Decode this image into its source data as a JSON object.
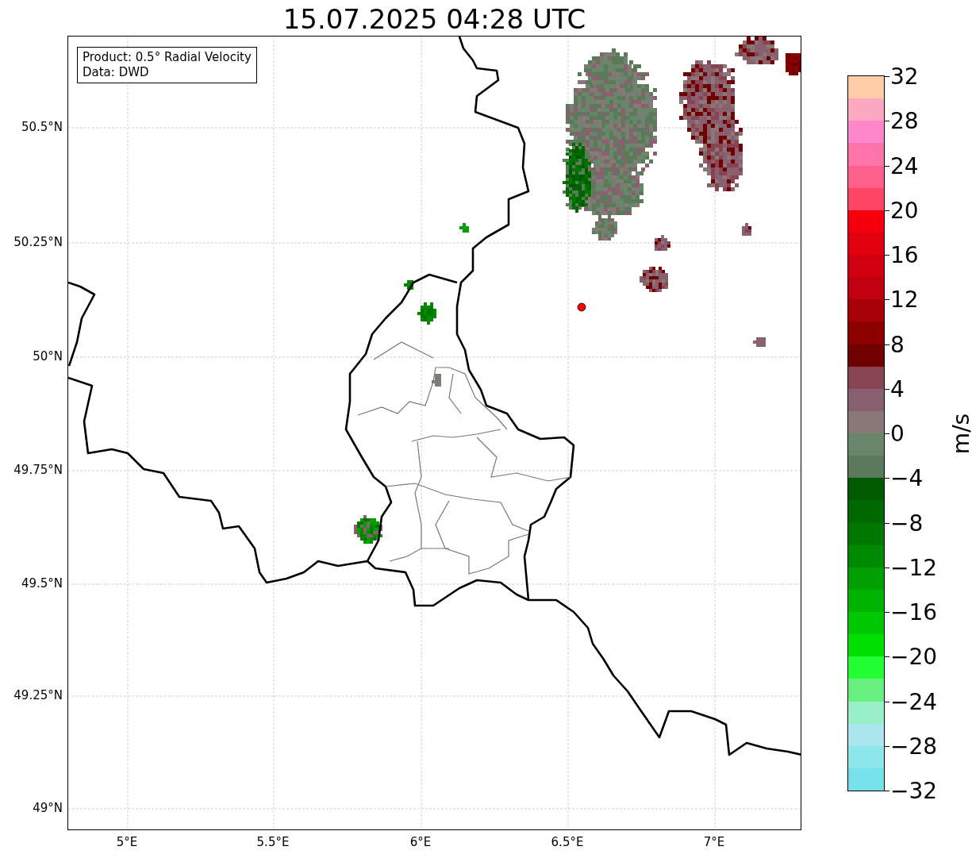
{
  "title": "15.07.2025 04:28 UTC",
  "info_box": {
    "lines": [
      "Product: 0.5° Radial Velocity",
      "Data: DWD"
    ]
  },
  "map": {
    "y_ticks": [
      "50.5°N",
      "50.25°N",
      "50°N",
      "49.75°N",
      "49.5°N",
      "49.25°N",
      "49°N"
    ],
    "x_ticks": [
      "5°E",
      "5.5°E",
      "6°E",
      "6.5°E",
      "7°E"
    ]
  },
  "colorbar": {
    "label": "m/s",
    "ticks": [
      "32",
      "28",
      "24",
      "20",
      "16",
      "12",
      "8",
      "4",
      "0",
      "−4",
      "−8",
      "−12",
      "−16",
      "−20",
      "−24",
      "−28",
      "−32"
    ],
    "segments": [
      {
        "color": "#ffcca8"
      },
      {
        "color": "#ffa8c4"
      },
      {
        "color": "#ff88cc"
      },
      {
        "color": "#ff74a8"
      },
      {
        "color": "#ff608c"
      },
      {
        "color": "#ff4466"
      },
      {
        "color": "#f5000c"
      },
      {
        "color": "#e0000e"
      },
      {
        "color": "#d00010"
      },
      {
        "color": "#c00010"
      },
      {
        "color": "#a80008"
      },
      {
        "color": "#8c0000"
      },
      {
        "color": "#700000"
      },
      {
        "color": "#884450"
      },
      {
        "color": "#886070"
      },
      {
        "color": "#887878"
      },
      {
        "color": "#6a866a"
      },
      {
        "color": "#5a7a5a"
      },
      {
        "color": "#005a00"
      },
      {
        "color": "#006800"
      },
      {
        "color": "#007800"
      },
      {
        "color": "#008a00"
      },
      {
        "color": "#00a000"
      },
      {
        "color": "#00b400"
      },
      {
        "color": "#00c800"
      },
      {
        "color": "#00e000"
      },
      {
        "color": "#22ff33"
      },
      {
        "color": "#66f080"
      },
      {
        "color": "#99f0c8"
      },
      {
        "color": "#abe6ee"
      },
      {
        "color": "#8ce8ec"
      },
      {
        "color": "#74e2e8"
      }
    ]
  }
}
